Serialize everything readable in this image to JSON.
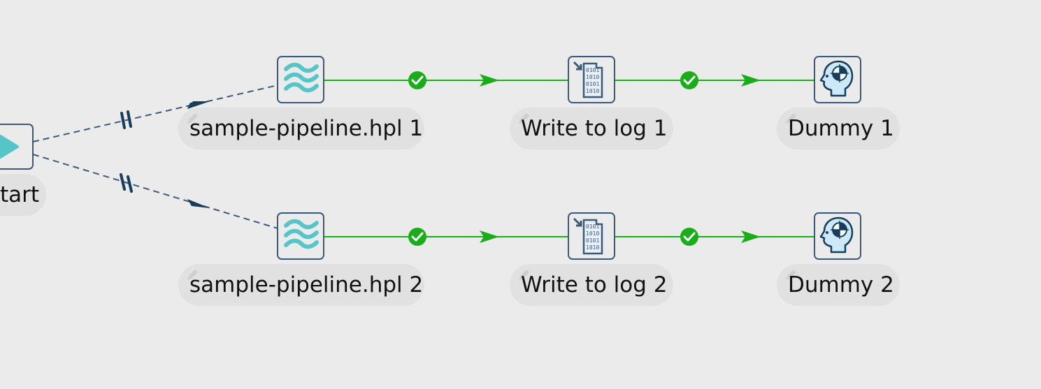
{
  "workflow": {
    "start": {
      "label": "Start",
      "visible_label": "tart"
    },
    "rows": [
      {
        "pipeline": {
          "label": "sample-pipeline.hpl 1"
        },
        "write_log": {
          "label": "Write to log 1"
        },
        "dummy": {
          "label": "Dummy 1"
        }
      },
      {
        "pipeline": {
          "label": "sample-pipeline.hpl 2"
        },
        "write_log": {
          "label": "Write to log 2"
        },
        "dummy": {
          "label": "Dummy 2"
        }
      }
    ],
    "hops": [
      {
        "from": "Start",
        "to": "sample-pipeline.hpl 1",
        "type": "parallel",
        "style": "dashed"
      },
      {
        "from": "Start",
        "to": "sample-pipeline.hpl 2",
        "type": "parallel",
        "style": "dashed"
      },
      {
        "from": "sample-pipeline.hpl 1",
        "to": "Write to log 1",
        "type": "success"
      },
      {
        "from": "Write to log 1",
        "to": "Dummy 1",
        "type": "success"
      },
      {
        "from": "sample-pipeline.hpl 2",
        "to": "Write to log 2",
        "type": "success"
      },
      {
        "from": "Write to log 2",
        "to": "Dummy 2",
        "type": "success"
      }
    ],
    "icons": {
      "start": "start-play-icon",
      "pipeline": "pipeline-waves-icon",
      "write_log": "write-to-log-binary-icon",
      "dummy": "dummy-head-target-icon",
      "success": "success-check-icon",
      "parallel": "parallel-bars-icon"
    },
    "colors": {
      "background": "#ebebeb",
      "node_border": "#3c5a78",
      "label_bg": "#e1e1e1",
      "success_hop": "#1aad1a",
      "parallel_hop": "#3c5a78",
      "arrow_dark": "#163d5c",
      "pipeline_teal": "#56c5c8"
    }
  }
}
